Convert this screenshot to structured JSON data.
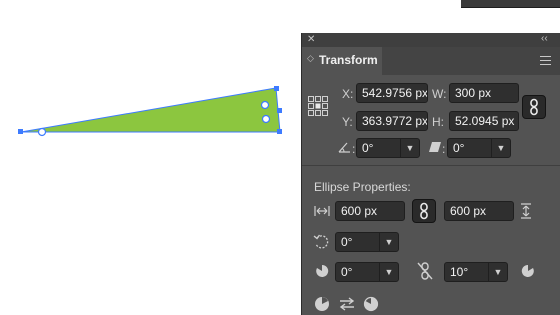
{
  "canvas": {
    "shape_fill": "#8cc63f",
    "selection_color": "#3d7bff"
  },
  "panel": {
    "close_glyph": "✕",
    "collapse_glyph": "‹‹",
    "tab_title": "Transform",
    "tab_arrows_glyph": "◇"
  },
  "transform": {
    "x_label": "X:",
    "x_value": "542.9756 px",
    "y_label": "Y:",
    "y_value": "363.9772 px",
    "w_label": "W:",
    "w_value": "300 px",
    "h_label": "H:",
    "h_value": "52.0945 px",
    "rotate_value": "0°",
    "shear_value": "0°"
  },
  "ellipse": {
    "section_title": "Ellipse Properties:",
    "width_value": "600 px",
    "height_value": "600 px",
    "angle_value": "0°",
    "pie_start_value": "0°",
    "pie_end_value": "10°"
  },
  "colors": {
    "panel_bg": "#535353",
    "field_bg": "#2f2f2f"
  }
}
